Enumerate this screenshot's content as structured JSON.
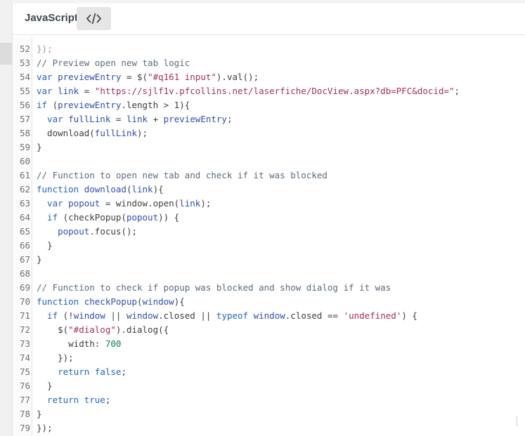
{
  "tab": {
    "label": "JavaScript",
    "code_toggle_icon": "code-icon"
  },
  "colors": {
    "comment": "#5a6c7d",
    "keyword": "#2563c5",
    "string": "#a62f5c",
    "number": "#0f7b5f",
    "variable": "#2f4fb3"
  },
  "partial_top_line": "});",
  "code_lines": [
    {
      "num": "52",
      "tokens": []
    },
    {
      "num": "53",
      "tokens": [
        {
          "t": "// Preview open new tab logic",
          "c": "comment"
        }
      ]
    },
    {
      "num": "54",
      "tokens": [
        {
          "t": "var ",
          "c": "kw"
        },
        {
          "t": "previewEntry",
          "c": "var"
        },
        {
          "t": " = $(",
          "c": "plain"
        },
        {
          "t": "\"#q161 input\"",
          "c": "str"
        },
        {
          "t": ").val();",
          "c": "plain"
        }
      ]
    },
    {
      "num": "55",
      "tokens": [
        {
          "t": "var ",
          "c": "kw"
        },
        {
          "t": "link",
          "c": "var"
        },
        {
          "t": " = ",
          "c": "plain"
        },
        {
          "t": "\"https://sjlf1v.pfcollins.net/laserfiche/DocView.aspx?db=PFC&docid=\"",
          "c": "str"
        },
        {
          "t": ";",
          "c": "plain"
        }
      ]
    },
    {
      "num": "56",
      "tokens": [
        {
          "t": "if ",
          "c": "kw"
        },
        {
          "t": "(",
          "c": "plain"
        },
        {
          "t": "previewEntry",
          "c": "var"
        },
        {
          "t": ".length > 1){",
          "c": "plain"
        }
      ]
    },
    {
      "num": "57",
      "tokens": [
        {
          "t": "  var ",
          "c": "kw"
        },
        {
          "t": "fullLink",
          "c": "var"
        },
        {
          "t": " = ",
          "c": "plain"
        },
        {
          "t": "link",
          "c": "var"
        },
        {
          "t": " + ",
          "c": "plain"
        },
        {
          "t": "previewEntry",
          "c": "var"
        },
        {
          "t": ";",
          "c": "plain"
        }
      ]
    },
    {
      "num": "58",
      "tokens": [
        {
          "t": "  download(",
          "c": "plain"
        },
        {
          "t": "fullLink",
          "c": "var"
        },
        {
          "t": ");",
          "c": "plain"
        }
      ]
    },
    {
      "num": "59",
      "tokens": [
        {
          "t": "}",
          "c": "plain"
        }
      ]
    },
    {
      "num": "60",
      "tokens": []
    },
    {
      "num": "61",
      "tokens": [
        {
          "t": "// Function to open new tab and check if it was blocked",
          "c": "comment"
        }
      ]
    },
    {
      "num": "62",
      "tokens": [
        {
          "t": "function ",
          "c": "kw"
        },
        {
          "t": "download",
          "c": "var"
        },
        {
          "t": "(",
          "c": "plain"
        },
        {
          "t": "link",
          "c": "var"
        },
        {
          "t": "){",
          "c": "plain"
        }
      ]
    },
    {
      "num": "63",
      "tokens": [
        {
          "t": "  var ",
          "c": "kw"
        },
        {
          "t": "popout",
          "c": "var"
        },
        {
          "t": " = window.open(",
          "c": "plain"
        },
        {
          "t": "link",
          "c": "var"
        },
        {
          "t": ");",
          "c": "plain"
        }
      ]
    },
    {
      "num": "64",
      "tokens": [
        {
          "t": "  if ",
          "c": "kw"
        },
        {
          "t": "(checkPopup(",
          "c": "plain"
        },
        {
          "t": "popout",
          "c": "var"
        },
        {
          "t": ")) {",
          "c": "plain"
        }
      ]
    },
    {
      "num": "65",
      "tokens": [
        {
          "t": "    popout",
          "c": "var"
        },
        {
          "t": ".focus();",
          "c": "plain"
        }
      ]
    },
    {
      "num": "66",
      "tokens": [
        {
          "t": "  }",
          "c": "plain"
        }
      ]
    },
    {
      "num": "67",
      "tokens": [
        {
          "t": "}",
          "c": "plain"
        }
      ]
    },
    {
      "num": "68",
      "tokens": []
    },
    {
      "num": "69",
      "tokens": [
        {
          "t": "// Function to check if popup was blocked and show dialog if it was",
          "c": "comment"
        }
      ]
    },
    {
      "num": "70",
      "tokens": [
        {
          "t": "function ",
          "c": "kw"
        },
        {
          "t": "checkPopup",
          "c": "var"
        },
        {
          "t": "(",
          "c": "plain"
        },
        {
          "t": "window",
          "c": "var"
        },
        {
          "t": "){",
          "c": "plain"
        }
      ]
    },
    {
      "num": "71",
      "tokens": [
        {
          "t": "  if ",
          "c": "kw"
        },
        {
          "t": "(!",
          "c": "plain"
        },
        {
          "t": "window",
          "c": "var"
        },
        {
          "t": " || ",
          "c": "plain"
        },
        {
          "t": "window",
          "c": "var"
        },
        {
          "t": ".closed || ",
          "c": "plain"
        },
        {
          "t": "typeof ",
          "c": "kw"
        },
        {
          "t": "window",
          "c": "var"
        },
        {
          "t": ".closed == ",
          "c": "plain"
        },
        {
          "t": "'undefined'",
          "c": "str"
        },
        {
          "t": ") {",
          "c": "plain"
        }
      ]
    },
    {
      "num": "72",
      "tokens": [
        {
          "t": "    $(",
          "c": "plain"
        },
        {
          "t": "\"#dialog\"",
          "c": "str"
        },
        {
          "t": ").dialog({",
          "c": "plain"
        }
      ]
    },
    {
      "num": "73",
      "tokens": [
        {
          "t": "      width: ",
          "c": "plain"
        },
        {
          "t": "700",
          "c": "num"
        }
      ]
    },
    {
      "num": "74",
      "tokens": [
        {
          "t": "    });",
          "c": "plain"
        }
      ]
    },
    {
      "num": "75",
      "tokens": [
        {
          "t": "    return ",
          "c": "kw"
        },
        {
          "t": "false",
          "c": "kw"
        },
        {
          "t": ";",
          "c": "plain"
        }
      ]
    },
    {
      "num": "76",
      "tokens": [
        {
          "t": "  }",
          "c": "plain"
        }
      ]
    },
    {
      "num": "77",
      "tokens": [
        {
          "t": "  return ",
          "c": "kw"
        },
        {
          "t": "true",
          "c": "kw"
        },
        {
          "t": ";",
          "c": "plain"
        }
      ]
    },
    {
      "num": "78",
      "tokens": [
        {
          "t": "}",
          "c": "plain"
        }
      ]
    },
    {
      "num": "79",
      "tokens": [
        {
          "t": "});",
          "c": "plain"
        }
      ]
    }
  ]
}
